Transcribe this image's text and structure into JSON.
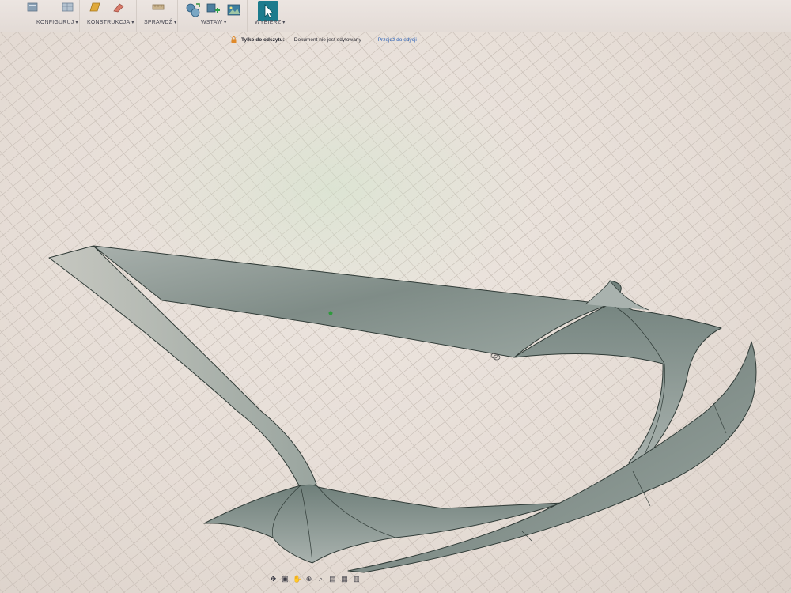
{
  "toolbar": {
    "groups": [
      {
        "label": "KONFIGURUJ"
      },
      {
        "label": "KONSTRUKCJA"
      },
      {
        "label": "SPRAWDŹ"
      },
      {
        "label": "WSTAW"
      },
      {
        "label": "WYBIERZ"
      }
    ]
  },
  "banner": {
    "readonly_label": "Tylko do odczytu:",
    "message": "Dokument nie jest edytowany",
    "action_link": "Przejdź do edycji"
  },
  "icons": {
    "lock": "lock-icon",
    "select": "cursor-arrow-icon",
    "insert_mesh": "insert-mesh-icon",
    "insert_svg": "insert-svg-icon",
    "insert_image": "insert-image-icon"
  },
  "colors": {
    "accent": "#1c7b8d",
    "model_surface": "#8f9b96",
    "grid": "#c7bdb5",
    "link": "#2e63b8"
  }
}
